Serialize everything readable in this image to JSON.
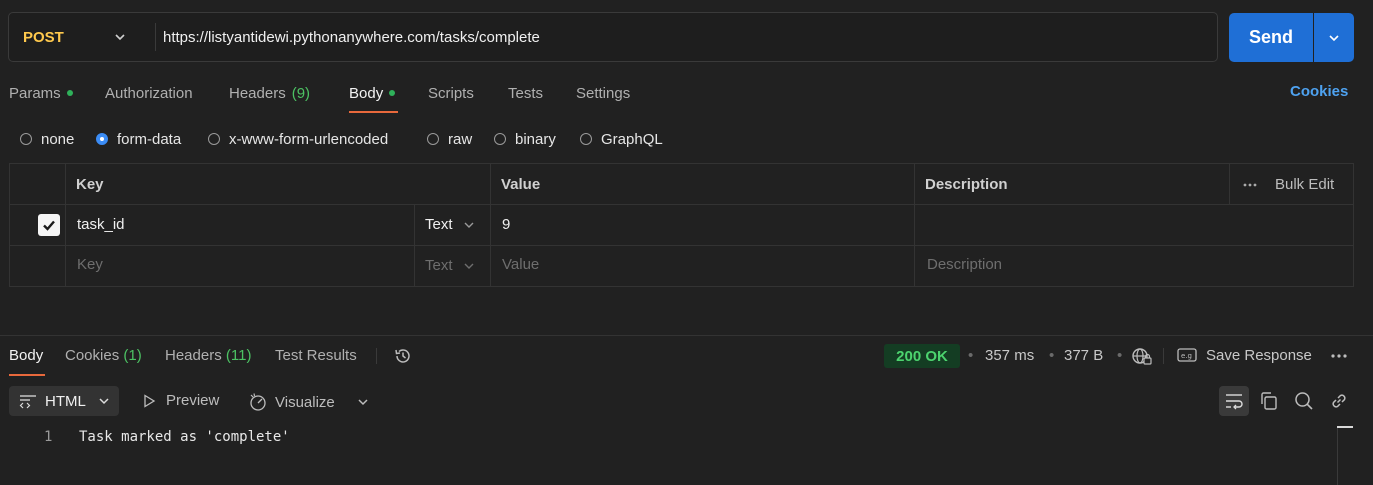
{
  "request": {
    "method": "POST",
    "url": "https://listyantidewi.pythonanywhere.com/tasks/complete",
    "send_label": "Send"
  },
  "tabs": {
    "params": "Params",
    "authorization": "Authorization",
    "headers": "Headers",
    "headers_count": "(9)",
    "body": "Body",
    "scripts": "Scripts",
    "tests": "Tests",
    "settings": "Settings",
    "cookies": "Cookies"
  },
  "body_types": {
    "none": "none",
    "form_data": "form-data",
    "urlencoded": "x-www-form-urlencoded",
    "raw": "raw",
    "binary": "binary",
    "graphql": "GraphQL",
    "selected": "form-data"
  },
  "form_table": {
    "headers": {
      "key": "Key",
      "value": "Value",
      "description": "Description",
      "bulk_edit": "Bulk Edit"
    },
    "rows": [
      {
        "checked": true,
        "key": "task_id",
        "type": "Text",
        "value": "9",
        "description": ""
      }
    ],
    "placeholder": {
      "key": "Key",
      "type": "Text",
      "value": "Value",
      "description": "Description"
    }
  },
  "response": {
    "tabs": {
      "body": "Body",
      "cookies": "Cookies",
      "cookies_count": "(1)",
      "headers": "Headers",
      "headers_count": "(11)",
      "test_results": "Test Results"
    },
    "status": "200 OK",
    "time": "357 ms",
    "size": "377 B",
    "save_label": "Save Response",
    "format": "HTML",
    "preview": "Preview",
    "visualize": "Visualize",
    "lines": [
      {
        "number": "1",
        "text": "Task marked as 'complete'"
      }
    ]
  },
  "colors": {
    "accent": "#1f6fd6",
    "method": "#ffc94d",
    "status_ok": "#4cd36e",
    "active_tab_underline": "#e8693c"
  },
  "icons": [
    "chevron-down-icon",
    "history-icon",
    "globe-lock-icon",
    "save-icon",
    "more-icon",
    "code-icon",
    "play-icon",
    "visualize-icon",
    "wrap-icon",
    "copy-icon",
    "search-icon",
    "link-icon",
    "ellipsis-icon"
  ]
}
